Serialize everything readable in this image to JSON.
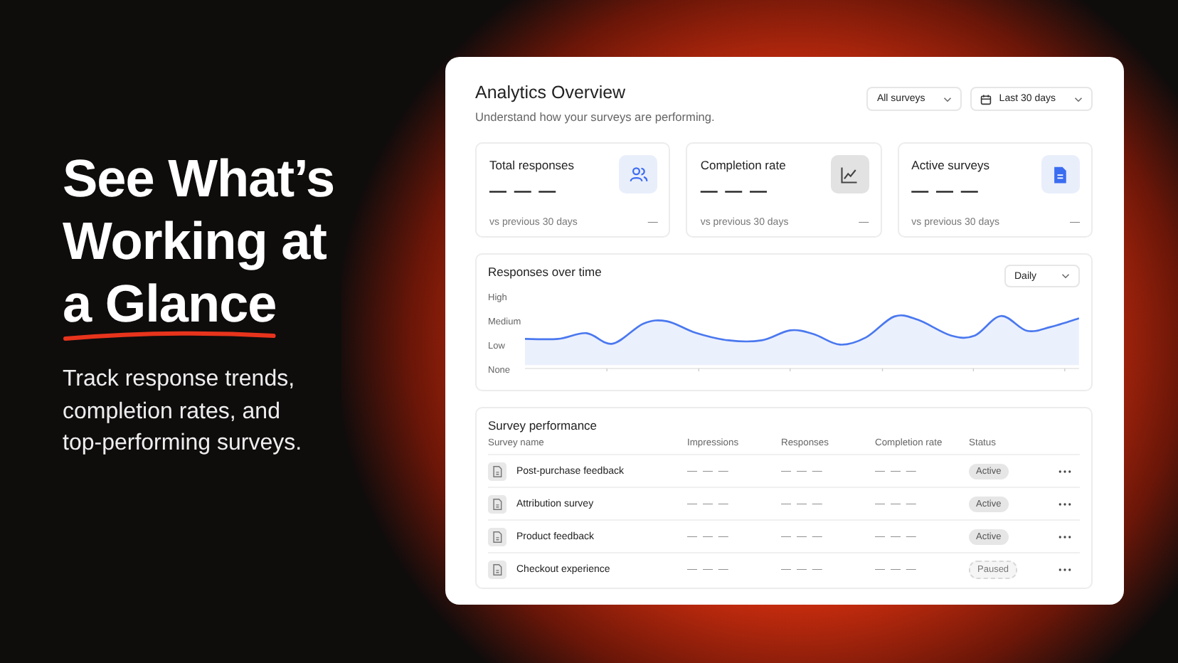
{
  "hero": {
    "headline": [
      {
        "text": "See What’s",
        "underlined": false
      },
      {
        "text": "Working at",
        "underlined": false
      },
      {
        "text": "a Glance",
        "underlined": true
      }
    ],
    "subtitle": "Track response trends, completion rates, and top-performing surveys."
  },
  "dashboard": {
    "title": "Analytics Overview",
    "subtitle": "Understand how your surveys are performing.",
    "filters": [
      {
        "label": "All surveys",
        "icon": false
      },
      {
        "label": "Last 30 days",
        "icon": true
      }
    ],
    "stats": [
      {
        "label": "Total responses",
        "value": "— — —",
        "comparison": "vs previous 30 days",
        "change": "—",
        "kind": "people"
      },
      {
        "label": "Completion rate",
        "value": "— — —",
        "comparison": "vs previous 30 days",
        "change": "—",
        "kind": "chart"
      },
      {
        "label": "Active surveys",
        "value": "— — —",
        "comparison": "vs previous 30 days",
        "change": "—",
        "kind": "document"
      }
    ],
    "trend": {
      "title": "Responses over time",
      "period": "Daily",
      "y_labels": [
        "High",
        "Medium",
        "Low",
        "None"
      ]
    },
    "table": {
      "title": "Survey performance",
      "columns": [
        "Survey name",
        "Impressions",
        "Responses",
        "Completion rate",
        "Status"
      ],
      "rows": [
        {
          "name": "Post-purchase feedback",
          "impressions": "— — —",
          "responses": "— — —",
          "completion": "— — —",
          "status": "Active",
          "kind": "active"
        },
        {
          "name": "Attribution survey",
          "impressions": "— — —",
          "responses": "— — —",
          "completion": "— — —",
          "status": "Active",
          "kind": "active"
        },
        {
          "name": "Product feedback",
          "impressions": "— — —",
          "responses": "— — —",
          "completion": "— — —",
          "status": "Active",
          "kind": "active"
        },
        {
          "name": "Checkout experience",
          "impressions": "— — —",
          "responses": "— — —",
          "completion": "— — —",
          "status": "Paused",
          "kind": "paused"
        }
      ]
    }
  }
}
